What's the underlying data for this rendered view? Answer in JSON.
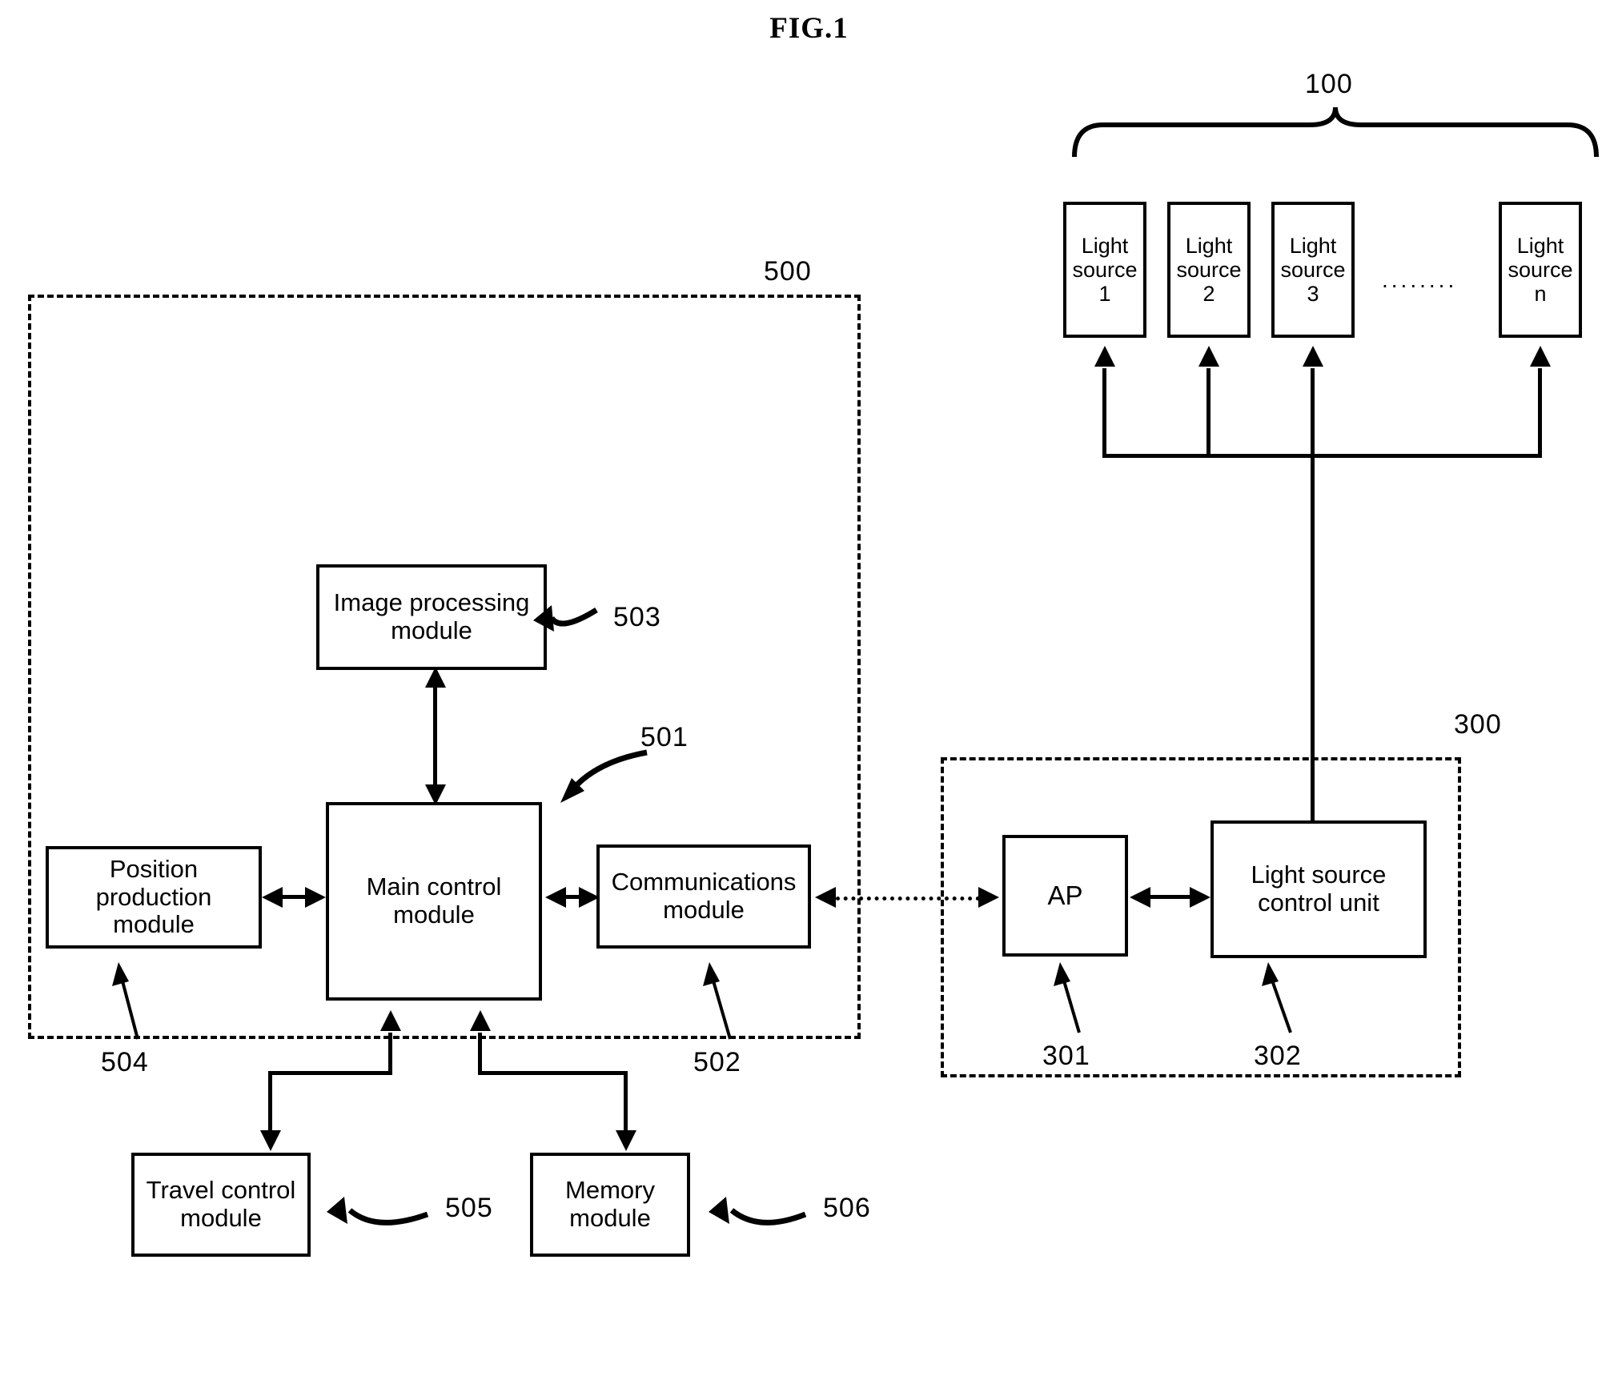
{
  "figure": {
    "title": "FIG.1"
  },
  "light_source_group": {
    "ref": "100",
    "ellipsis": "........",
    "sources": [
      {
        "line1": "Light",
        "line2": "source",
        "line3": "1"
      },
      {
        "line1": "Light",
        "line2": "source",
        "line3": "2"
      },
      {
        "line1": "Light",
        "line2": "source",
        "line3": "3"
      },
      {
        "line1": "Light",
        "line2": "source",
        "line3": "n"
      }
    ]
  },
  "robot": {
    "ref": "500",
    "modules": [
      {
        "ref": "503",
        "line1": "Image processing",
        "line2": "module"
      },
      {
        "ref": "501",
        "line1": "Main control",
        "line2": "module"
      },
      {
        "ref": "504",
        "line1": "Position production",
        "line2": "module"
      },
      {
        "ref": "502",
        "line1": "Communications",
        "line2": "module"
      },
      {
        "ref": "505",
        "line1": "Travel control",
        "line2": "module"
      },
      {
        "ref": "506",
        "line1": "Memory",
        "line2": "module"
      }
    ]
  },
  "light_control_system": {
    "ref": "300",
    "units": [
      {
        "ref": "301",
        "line1": "AP",
        "line2": ""
      },
      {
        "ref": "302",
        "line1": "Light source",
        "line2": "control unit"
      }
    ]
  }
}
